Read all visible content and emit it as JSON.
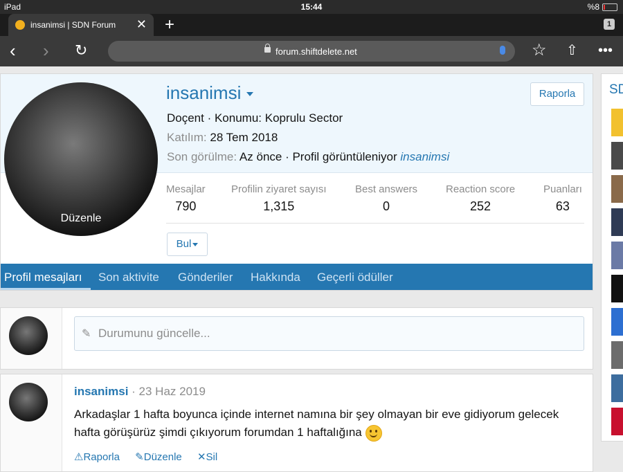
{
  "status_bar": {
    "device": "iPad",
    "time": "15:44",
    "battery": "%8"
  },
  "browser": {
    "tab_title": "insanimsi | SDN Forum",
    "tab_count": "1",
    "url": "forum.shiftdelete.net"
  },
  "profile": {
    "username": "insanimsi",
    "avatar_edit": "Düzenle",
    "title_line": "Doçent · Konumu: Koprulu Sector",
    "joined_label": "Katılım:",
    "joined_value": "28 Tem 2018",
    "last_seen_label": "Son görülme:",
    "last_seen_value": "Az önce · Profil görüntüleniyor",
    "last_seen_user": "insanimsi",
    "report_label": "Raporla",
    "find_label": "Bul",
    "stats": [
      {
        "label": "Mesajlar",
        "value": "790"
      },
      {
        "label": "Profilin ziyaret sayısı",
        "value": "1,315"
      },
      {
        "label": "Best answers",
        "value": "0"
      },
      {
        "label": "Reaction score",
        "value": "252"
      },
      {
        "label": "Puanları",
        "value": "63"
      }
    ],
    "tabs": [
      "Profil mesajları",
      "Son aktivite",
      "Gönderiler",
      "Hakkında",
      "Geçerli ödüller"
    ]
  },
  "status_update": {
    "placeholder": "Durumunu güncelle..."
  },
  "post": {
    "author": "insanimsi",
    "date": "· 23 Haz 2019",
    "text": "Arkadaşlar 1 hafta boyunca içinde internet namına bir şey olmayan bir eve gidiyorum gelecek hafta görüşürüz şimdi çıkıyorum forumdan 1 haftalığına",
    "actions": [
      "Raporla",
      "Düzenle",
      "Sil"
    ]
  },
  "sidebar": {
    "title": "SD"
  }
}
